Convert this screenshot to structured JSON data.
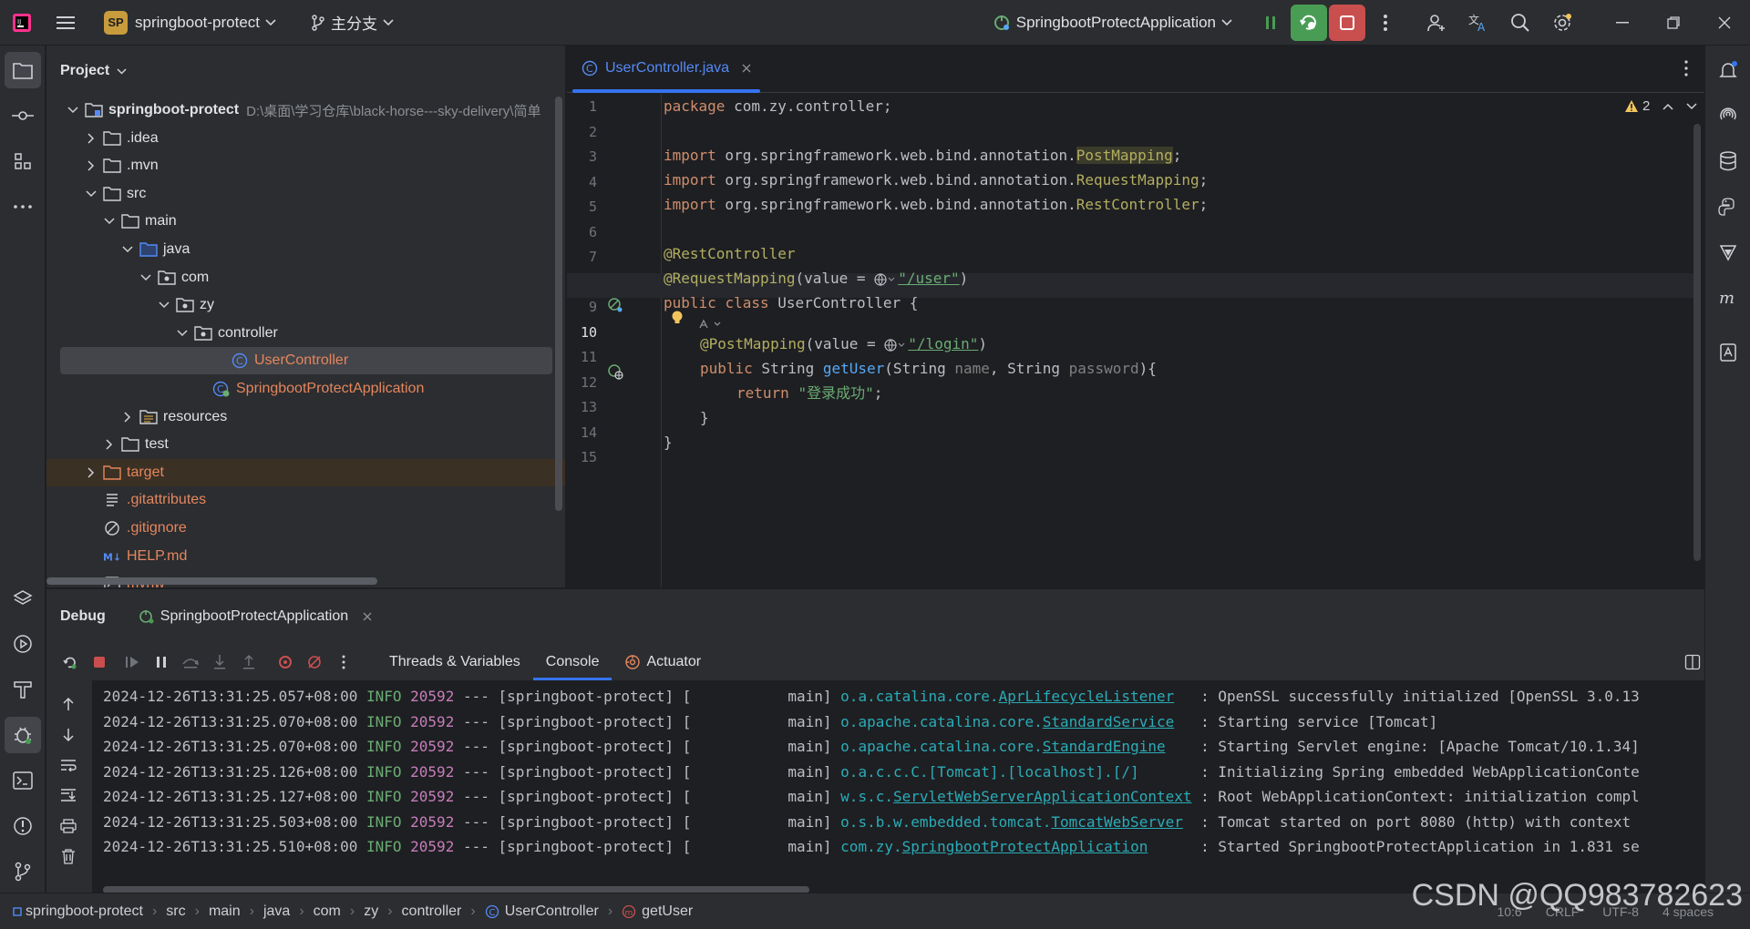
{
  "titlebar": {
    "project_name": "springboot-protect",
    "project_badge": "SP",
    "branch": "主分支",
    "run_config": "SpringbootProtectApplication"
  },
  "project_panel": {
    "title": "Project",
    "tree": [
      {
        "label": "springboot-protect",
        "path": "D:\\桌面\\学习仓库\\black-horse---sky-delivery\\简单",
        "type": "module",
        "expanded": true
      },
      {
        "label": ".idea",
        "type": "folder",
        "expanded": false
      },
      {
        "label": ".mvn",
        "type": "folder",
        "expanded": false
      },
      {
        "label": "src",
        "type": "folder",
        "expanded": true
      },
      {
        "label": "main",
        "type": "folder",
        "expanded": true
      },
      {
        "label": "java",
        "type": "source-folder",
        "expanded": true
      },
      {
        "label": "com",
        "type": "package",
        "expanded": true
      },
      {
        "label": "zy",
        "type": "package",
        "expanded": true
      },
      {
        "label": "controller",
        "type": "package",
        "expanded": true
      },
      {
        "label": "UserController",
        "type": "class",
        "selected": true
      },
      {
        "label": "SpringbootProtectApplication",
        "type": "app-class"
      },
      {
        "label": "resources",
        "type": "resources",
        "expanded": false
      },
      {
        "label": "test",
        "type": "folder",
        "expanded": false
      },
      {
        "label": "target",
        "type": "excluded-folder",
        "expanded": false
      },
      {
        "label": ".gitattributes",
        "type": "file"
      },
      {
        "label": ".gitignore",
        "type": "ignore-file"
      },
      {
        "label": "HELP.md",
        "type": "markdown"
      },
      {
        "label": "mvnw",
        "type": "script"
      }
    ]
  },
  "editor": {
    "tab": "UserController.java",
    "warnings": "2",
    "lines": [
      {
        "n": "1",
        "code": "package com.zy.controller;"
      },
      {
        "n": "2",
        "code": ""
      },
      {
        "n": "3",
        "code": "import org.springframework.web.bind.annotation.PostMapping;"
      },
      {
        "n": "4",
        "code": "import org.springframework.web.bind.annotation.RequestMapping;"
      },
      {
        "n": "5",
        "code": "import org.springframework.web.bind.annotation.RestController;"
      },
      {
        "n": "6",
        "code": ""
      },
      {
        "n": "7",
        "code": "@RestController"
      },
      {
        "n": "8",
        "code": "@RequestMapping(value = \"/user\")"
      },
      {
        "n": "9",
        "code": "public class UserController {"
      },
      {
        "n": "10",
        "code": "@PostMapping(value = \"/login\")"
      },
      {
        "n": "11",
        "code": "public String getUser(String name, String password){"
      },
      {
        "n": "12",
        "code": "return \"登录成功\";"
      },
      {
        "n": "13",
        "code": "}"
      },
      {
        "n": "14",
        "code": "}"
      },
      {
        "n": "15",
        "code": ""
      }
    ],
    "tokens": {
      "package_kw": "package",
      "package_name": " com.zy.controller;",
      "import_kw": "import",
      "import_prefix": " org.springframework.web.bind.annotation.",
      "imp1": "PostMapping",
      "imp2": "RequestMapping",
      "imp3": "RestController",
      "semicolon": ";",
      "ann_rest": "@RestController",
      "ann_req": "@RequestMapping",
      "value_eq": "(value = ",
      "path_user": "\"/user\"",
      "close_paren": ")",
      "public_kw": "public",
      "class_kw": "class",
      "class_decl": " UserController {",
      "ann_post": "@PostMapping",
      "path_login": "\"/login\"",
      "string_type": " String ",
      "method_name": "getUser",
      "open_paren": "(String ",
      "p_name": "name",
      "comma_string": ", String ",
      "p_password": "password",
      "brace_open": "){",
      "return_kw": "return",
      "return_val": "\"登录成功\"",
      "close_brace": "}"
    }
  },
  "debug": {
    "title": "Debug",
    "session": "SpringbootProtectApplication",
    "tabs": [
      "Threads & Variables",
      "Console",
      "Actuator"
    ],
    "active_tab": "Console",
    "log": [
      {
        "ts": "2024-12-26T13:31:25.057+08:00",
        "level": "INFO",
        "pid": "20592",
        "mid": " --- [springboot-protect] [           main] ",
        "logger_prefix": "o.a.catalina.core.",
        "logger_link": "AprLifecycleListener",
        "msg": "   : OpenSSL successfully initialized [OpenSSL 3.0.13"
      },
      {
        "ts": "2024-12-26T13:31:25.070+08:00",
        "level": "INFO",
        "pid": "20592",
        "mid": " --- [springboot-protect] [           main] ",
        "logger_prefix": "o.apache.catalina.core.",
        "logger_link": "StandardService",
        "msg": "   : Starting service [Tomcat]"
      },
      {
        "ts": "2024-12-26T13:31:25.070+08:00",
        "level": "INFO",
        "pid": "20592",
        "mid": " --- [springboot-protect] [           main] ",
        "logger_prefix": "o.apache.catalina.core.",
        "logger_link": "StandardEngine",
        "msg": "    : Starting Servlet engine: [Apache Tomcat/10.1.34]"
      },
      {
        "ts": "2024-12-26T13:31:25.126+08:00",
        "level": "INFO",
        "pid": "20592",
        "mid": " --- [springboot-protect] [           main] ",
        "logger_prefix": "o.a.c.c.C.[Tomcat].[localhost].[/]",
        "logger_link": "",
        "msg": "       : Initializing Spring embedded WebApplicationConte"
      },
      {
        "ts": "2024-12-26T13:31:25.127+08:00",
        "level": "INFO",
        "pid": "20592",
        "mid": " --- [springboot-protect] [           main] ",
        "logger_prefix": "w.s.c.",
        "logger_link": "ServletWebServerApplicationContext",
        "msg": " : Root WebApplicationContext: initialization compl"
      },
      {
        "ts": "2024-12-26T13:31:25.503+08:00",
        "level": "INFO",
        "pid": "20592",
        "mid": " --- [springboot-protect] [           main] ",
        "logger_prefix": "o.s.b.w.embedded.tomcat.",
        "logger_link": "TomcatWebServer",
        "msg": "  : Tomcat started on port 8080 (http) with context"
      },
      {
        "ts": "2024-12-26T13:31:25.510+08:00",
        "level": "INFO",
        "pid": "20592",
        "mid": " --- [springboot-protect] [           main] ",
        "logger_prefix": "com.zy.",
        "logger_link": "SpringbootProtectApplication",
        "msg": "      : Started SpringbootProtectApplication in 1.831 se"
      }
    ]
  },
  "statusbar": {
    "breadcrumbs": [
      "springboot-protect",
      "src",
      "main",
      "java",
      "com",
      "zy",
      "controller",
      "UserController",
      "getUser"
    ],
    "right": [
      "10:6",
      "CRLF",
      "UTF-8",
      "4 spaces"
    ]
  },
  "watermark": "CSDN @QQ983782623",
  "colors": {
    "accent": "#3574f0",
    "run_green": "#499c54",
    "stop_red": "#c94f4f",
    "warning": "#f2c55c"
  }
}
